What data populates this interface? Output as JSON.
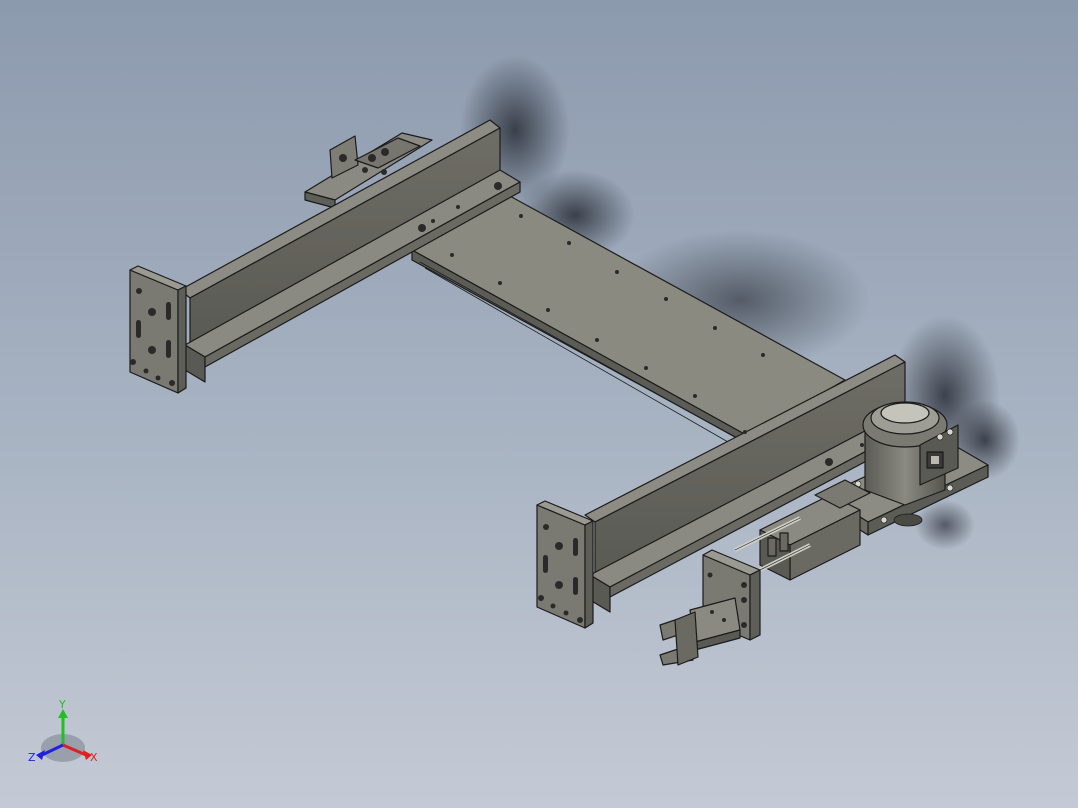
{
  "triad": {
    "x_label": "X",
    "y_label": "Y",
    "z_label": "Z",
    "x_color": "#e02020",
    "y_color": "#20c020",
    "z_color": "#2020e0"
  },
  "colors": {
    "bg_top": "#8c9aae",
    "bg_bottom": "#c4cad5",
    "metal_light": "#8f8f86",
    "metal_mid": "#6f6f68",
    "metal_dark": "#4e4e49",
    "plate_top": "#8a8a81"
  }
}
